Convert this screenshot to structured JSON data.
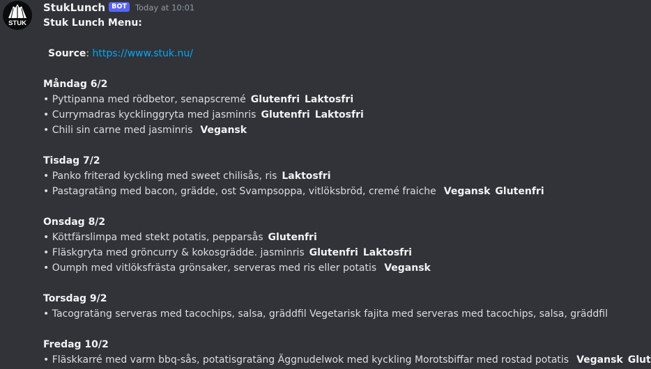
{
  "bot": {
    "username": "StukLunch",
    "badge": "BOT",
    "timestamp": "Today at 10:01",
    "avatar_text": "STUK"
  },
  "message": {
    "title": "Stuk Lunch Menu:",
    "source_label": "Source",
    "source_sep": ":",
    "source_url": "https://www.stuk.nu/",
    "days": [
      {
        "heading": "Måndag 6/2",
        "items": [
          {
            "text": "• Pyttipanna med rödbetor, senapscremé",
            "tags": [
              "Glutenfri",
              "Laktosfri"
            ]
          },
          {
            "text": "• Currymadras kycklinggryta med jasminris",
            "tags": [
              "Glutenfri",
              "Laktosfri"
            ]
          },
          {
            "text": "• Chili sin carne med jasminris",
            "tags": [
              "Vegansk"
            ]
          }
        ]
      },
      {
        "heading": "Tisdag 7/2",
        "items": [
          {
            "text": "• Panko friterad kyckling med sweet chilisås, ris",
            "tags": [
              "Laktosfri"
            ]
          },
          {
            "text": "• Pastagratäng med bacon, grädde, ost Svampsoppa, vitlöksbröd, cremé fraiche",
            "tags": [
              "Vegansk",
              "Glutenfri"
            ]
          }
        ]
      },
      {
        "heading": "Onsdag 8/2",
        "items": [
          {
            "text": "• Köttfärslimpa med stekt potatis, pepparsås",
            "tags": [
              "Glutenfri"
            ]
          },
          {
            "text": "• Fläskgryta med gröncurry & kokosgrädde. jasminris",
            "tags": [
              "Glutenfri",
              "Laktosfri"
            ]
          },
          {
            "text": "• Oumph med vitlöksfrästa grönsaker, serveras med ris eller potatis",
            "tags": [
              "Vegansk"
            ]
          }
        ]
      },
      {
        "heading": "Torsdag 9/2",
        "items": [
          {
            "text": "• Tacogratäng serveras med tacochips, salsa, gräddfil Vegetarisk fajita med serveras med tacochips, salsa, gräddfil",
            "tags": []
          }
        ]
      },
      {
        "heading": "Fredag 10/2",
        "items": [
          {
            "text": "• Fläskkarré med varm bbq-sås, potatisgratäng Äggnudelwok med kyckling Morotsbiffar med rostad potatis",
            "tags": [
              "Vegansk",
              "Glutenfri"
            ]
          }
        ]
      }
    ]
  }
}
